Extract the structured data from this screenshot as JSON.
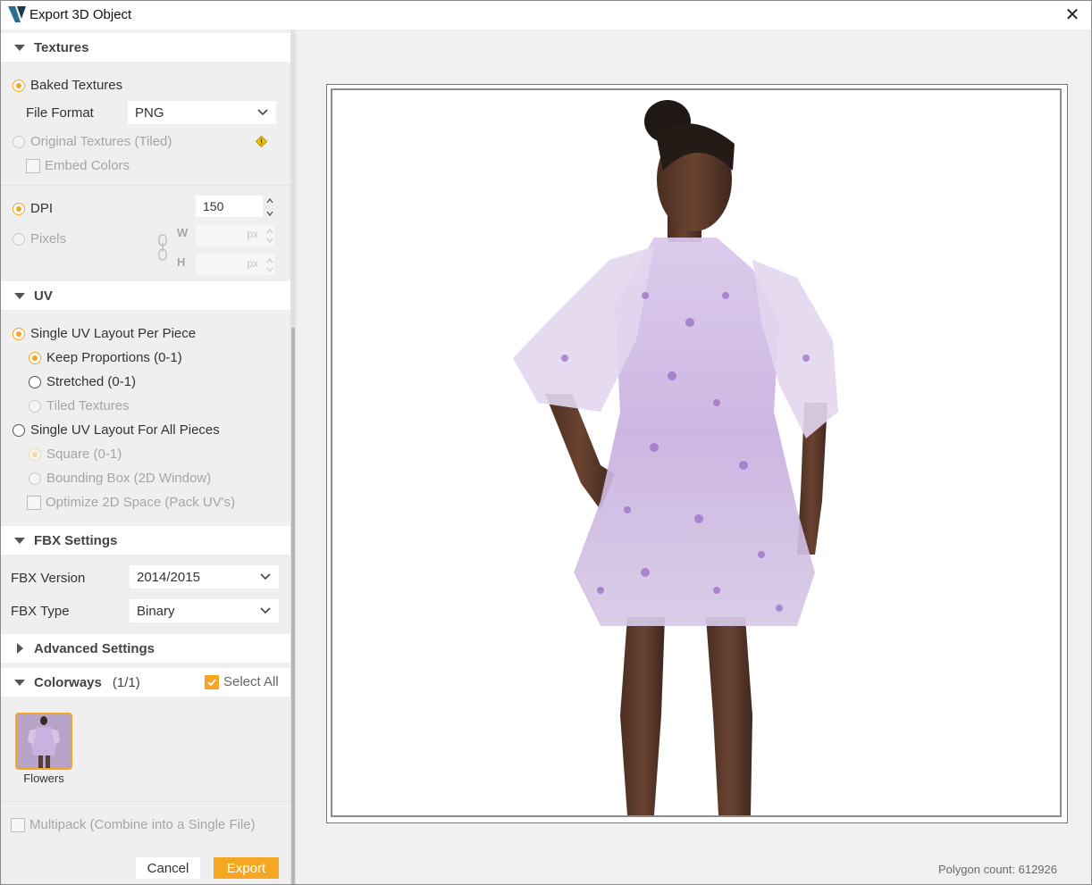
{
  "window": {
    "title": "Export 3D Object",
    "close_glyph": "✕"
  },
  "textures": {
    "header": "Textures",
    "baked": "Baked Textures",
    "file_format_label": "File Format",
    "file_format_value": "PNG",
    "original": "Original Textures (Tiled)",
    "embed_colors": "Embed Colors",
    "dpi_label": "DPI",
    "dpi_value": "150",
    "pixels_label": "Pixels",
    "w_label": "W",
    "h_label": "H",
    "px_unit": "px"
  },
  "uv": {
    "header": "UV",
    "single_per_piece": "Single UV Layout Per Piece",
    "keep_proportions": "Keep Proportions (0-1)",
    "stretched": "Stretched (0-1)",
    "tiled": "Tiled Textures",
    "single_all": "Single UV Layout For All Pieces",
    "square": "Square (0-1)",
    "bounding_box": "Bounding Box (2D Window)",
    "optimize": "Optimize 2D Space (Pack UV's)"
  },
  "fbx": {
    "header": "FBX Settings",
    "version_label": "FBX Version",
    "version_value": "2014/2015",
    "type_label": "FBX Type",
    "type_value": "Binary"
  },
  "advanced": {
    "header": "Advanced Settings"
  },
  "colorways": {
    "header": "Colorways",
    "count": "(1/1)",
    "select_all": "Select All",
    "items": [
      {
        "label": "Flowers"
      }
    ]
  },
  "multipack": "Multipack (Combine into a Single File)",
  "buttons": {
    "cancel": "Cancel",
    "export": "Export"
  },
  "preview": {
    "polygon_count": "Polygon count: 612926"
  },
  "colors": {
    "accent": "#f5a623",
    "panel": "#efefef",
    "preview_bg": "#f0f0f0"
  }
}
